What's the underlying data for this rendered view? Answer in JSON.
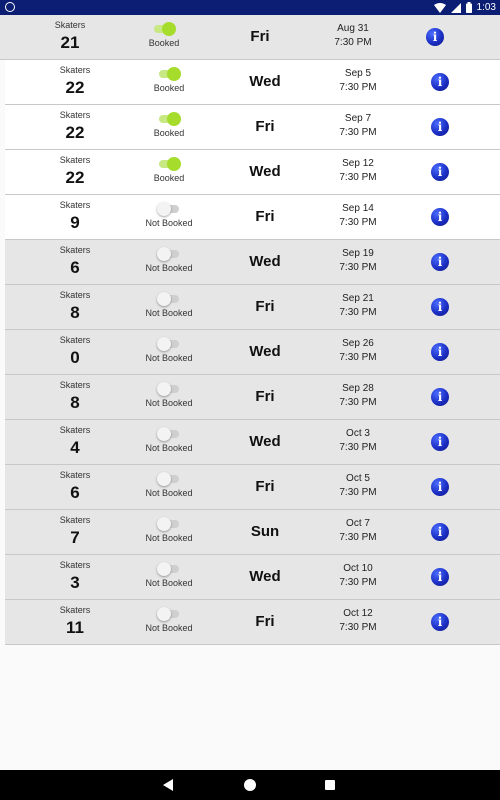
{
  "status_bar": {
    "time": "1:03"
  },
  "labels": {
    "skaters": "Skaters"
  },
  "rows": [
    {
      "count": "21",
      "booked": true,
      "status": "Booked",
      "day": "Fri",
      "date": "Aug 31",
      "time": "7:30 PM"
    },
    {
      "count": "22",
      "booked": true,
      "status": "Booked",
      "day": "Wed",
      "date": "Sep 5",
      "time": "7:30 PM"
    },
    {
      "count": "22",
      "booked": true,
      "status": "Booked",
      "day": "Fri",
      "date": "Sep 7",
      "time": "7:30 PM"
    },
    {
      "count": "22",
      "booked": true,
      "status": "Booked",
      "day": "Wed",
      "date": "Sep 12",
      "time": "7:30 PM"
    },
    {
      "count": "9",
      "booked": false,
      "status": "Not Booked",
      "day": "Fri",
      "date": "Sep 14",
      "time": "7:30 PM"
    },
    {
      "count": "6",
      "booked": false,
      "status": "Not Booked",
      "day": "Wed",
      "date": "Sep 19",
      "time": "7:30 PM"
    },
    {
      "count": "8",
      "booked": false,
      "status": "Not Booked",
      "day": "Fri",
      "date": "Sep 21",
      "time": "7:30 PM"
    },
    {
      "count": "0",
      "booked": false,
      "status": "Not Booked",
      "day": "Wed",
      "date": "Sep 26",
      "time": "7:30 PM"
    },
    {
      "count": "8",
      "booked": false,
      "status": "Not Booked",
      "day": "Fri",
      "date": "Sep 28",
      "time": "7:30 PM"
    },
    {
      "count": "4",
      "booked": false,
      "status": "Not Booked",
      "day": "Wed",
      "date": "Oct 3",
      "time": "7:30 PM"
    },
    {
      "count": "6",
      "booked": false,
      "status": "Not Booked",
      "day": "Fri",
      "date": "Oct 5",
      "time": "7:30 PM"
    },
    {
      "count": "7",
      "booked": false,
      "status": "Not Booked",
      "day": "Sun",
      "date": "Oct 7",
      "time": "7:30 PM"
    },
    {
      "count": "3",
      "booked": false,
      "status": "Not Booked",
      "day": "Wed",
      "date": "Oct 10",
      "time": "7:30 PM"
    },
    {
      "count": "11",
      "booked": false,
      "status": "Not Booked",
      "day": "Fri",
      "date": "Oct 12",
      "time": "7:30 PM"
    }
  ],
  "icons": {
    "info": "i",
    "status_left": "circle-icon",
    "status_right": [
      "wifi-icon",
      "signal-icon",
      "battery-icon"
    ],
    "nav": [
      "back-icon",
      "home-icon",
      "recents-icon"
    ]
  },
  "colors": {
    "status_bar": "#0b1e73",
    "toggle_on": "#a6dc2c",
    "info_button": "#1c2fc4",
    "grey_row": "#e6e6e6"
  }
}
